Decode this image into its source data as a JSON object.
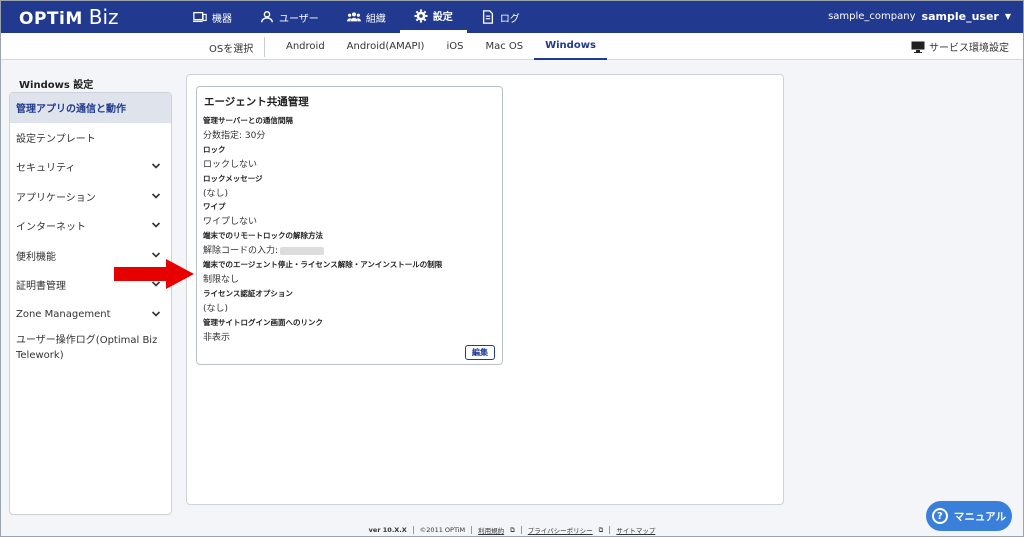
{
  "header": {
    "logo_main": "OPTiM",
    "logo_sub": "Biz",
    "nav": [
      {
        "label": "機器",
        "icon": "device-icon"
      },
      {
        "label": "ユーザー",
        "icon": "user-icon"
      },
      {
        "label": "組織",
        "icon": "group-icon"
      },
      {
        "label": "設定",
        "icon": "gear-icon"
      },
      {
        "label": "ログ",
        "icon": "log-icon"
      }
    ],
    "company": "sample_company",
    "username": "sample_user"
  },
  "subbar": {
    "os_select": "OSを選択",
    "tabs": [
      "Android",
      "Android(AMAPI)",
      "iOS",
      "Mac OS",
      "Windows"
    ],
    "active_tab": "Windows",
    "service_settings": "サービス環境設定"
  },
  "sidebar": {
    "title": "Windows 設定",
    "items": [
      {
        "label": "管理アプリの通信と動作"
      },
      {
        "label": "設定テンプレート"
      },
      {
        "label": "セキュリティ"
      },
      {
        "label": "アプリケーション"
      },
      {
        "label": "インターネット"
      },
      {
        "label": "便利機能"
      },
      {
        "label": "証明書管理"
      },
      {
        "label": "Zone Management"
      },
      {
        "label": "ユーザー操作ログ(Optimal Biz Telework)"
      }
    ]
  },
  "card": {
    "title": "エージェント共通管理",
    "fields": [
      {
        "label": "管理サーバーとの通信間隔",
        "value": "分数指定: 30分"
      },
      {
        "label": "ロック",
        "value": "ロックしない"
      },
      {
        "label": "ロックメッセージ",
        "value": "(なし)"
      },
      {
        "label": "ワイプ",
        "value": "ワイプしない"
      },
      {
        "label": "端末でのリモートロックの解除方法",
        "value": "解除コードの入力:"
      },
      {
        "label": "端末でのエージェント停止・ライセンス解除・アンインストールの制限",
        "value": "制限なし"
      },
      {
        "label": "ライセンス認証オプション",
        "value": "(なし)"
      },
      {
        "label": "管理サイトログイン画面へのリンク",
        "value": "非表示"
      }
    ],
    "edit_label": "編集"
  },
  "footer": {
    "version": "ver 10.X.X",
    "copyright": "©2011 OPTiM",
    "terms": "利用規約",
    "privacy": "プライバシーポリシー",
    "sitemap": "サイトマップ"
  },
  "manual_button": "マニュアル",
  "colors": {
    "brand": "#213a8f",
    "arrow": "#e60000",
    "manual": "#3a7fd9"
  }
}
